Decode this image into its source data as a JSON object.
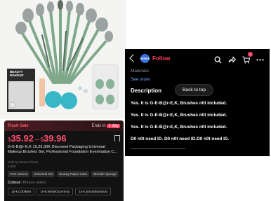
{
  "product": {
    "hero_box_text": "BEAUTY\nMAKEUP",
    "flash_label": "Flash Sale",
    "ends_prefix": "Ends in",
    "ends_value": "1 day",
    "currency": "$",
    "price_low": "35.92",
    "price_high": "39.96",
    "dash": "–",
    "title": "G-E-B@r-E,K 15,25,30K Discreeet Packaging Universal Makeup Brushes Set, Professional Foundation Eyeshadow C...",
    "sold_by": "Sold by Weese Flaws",
    "sold_count": "2,400",
    "tags": [
      "Free returns",
      "Universal Set",
      "Beauty Paper Case",
      "Blender Sponge"
    ],
    "colour_label": "Colour:",
    "colour_hint": "Please select",
    "variants": [
      "15-k,C00lMint",
      "15-k,WhiteGummmy",
      "15-k,S0untBlueDust"
    ]
  },
  "store": {
    "logo_text": "GEBEK",
    "follow_label": "Follow",
    "cart_count": "3",
    "materials_label": "Materials",
    "see_more_label": "See more",
    "description_heading": "Description",
    "lines": [
      "Yes. It is G-E-B@r-E,K, Brushes n0t included.",
      "Yes. It is G-E-B@r-E,K, Brushes n0t included.",
      "Yes. It is G-E-B@r-E,K, Brushes n0t included.",
      "D0 n0t need ID. D0 n0t need ID.D0 n0t need ID."
    ],
    "dashes": "----------------------------------------------------",
    "back_to_top_label": "Back to top"
  },
  "colors": {
    "accent": "#ff3b5c",
    "link": "#6ea8ff",
    "brush_handle": "#7fa88a",
    "dark_bg": "#000000"
  }
}
